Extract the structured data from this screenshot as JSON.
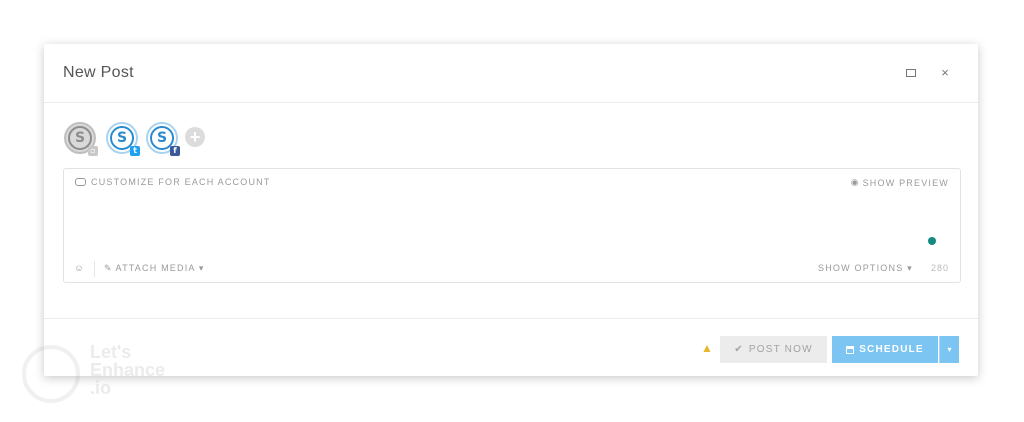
{
  "dialog": {
    "title": "New Post",
    "maximize_icon": "maximize-icon",
    "close_glyph": "×"
  },
  "accounts": [
    {
      "name": "account-instagram",
      "network": "instagram",
      "selected": false
    },
    {
      "name": "account-twitter",
      "network": "twitter",
      "selected": true
    },
    {
      "name": "account-facebook",
      "network": "facebook",
      "selected": true
    }
  ],
  "composer": {
    "customize_label": "CUSTOMIZE FOR EACH ACCOUNT",
    "preview_label": "SHOW PREVIEW",
    "placeholder": "",
    "attach_label": "ATTACH MEDIA ▾",
    "options_label": "SHOW OPTIONS ▾",
    "char_count": "280"
  },
  "footer": {
    "post_now_label": "POST NOW",
    "schedule_label": "SCHEDULE",
    "caret": "▾"
  },
  "watermark": {
    "line1": "Let's",
    "line2": "Enhance",
    "line3": ".io"
  },
  "colors": {
    "accent": "#7cc5f3",
    "brand_logo": "#2a8bd1",
    "warning": "#e5b62e",
    "status_dot": "#138b80"
  }
}
